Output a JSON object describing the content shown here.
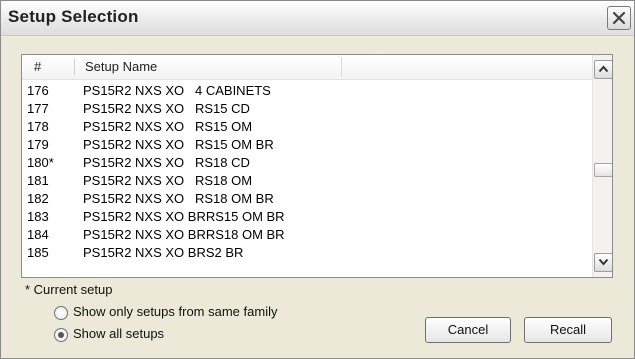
{
  "window": {
    "title": "Setup Selection"
  },
  "list": {
    "columns": [
      "#",
      "Setup Name"
    ],
    "rows": [
      {
        "num": "176",
        "name": "PS15R2 NXS XO   4 CABINETS"
      },
      {
        "num": "177",
        "name": "PS15R2 NXS XO   RS15 CD"
      },
      {
        "num": "178",
        "name": "PS15R2 NXS XO   RS15 OM"
      },
      {
        "num": "179",
        "name": "PS15R2 NXS XO   RS15 OM BR"
      },
      {
        "num": "180*",
        "name": "PS15R2 NXS XO   RS18 CD"
      },
      {
        "num": "181",
        "name": "PS15R2 NXS XO   RS18 OM"
      },
      {
        "num": "182",
        "name": "PS15R2 NXS XO   RS18 OM BR"
      },
      {
        "num": "183",
        "name": "PS15R2 NXS XO BRRS15 OM BR"
      },
      {
        "num": "184",
        "name": "PS15R2 NXS XO BRRS18 OM BR"
      },
      {
        "num": "185",
        "name": "PS15R2 NXS XO BRS2 BR"
      }
    ]
  },
  "footnote": "* Current setup",
  "options": [
    {
      "label": "Show only setups from same family",
      "checked": false
    },
    {
      "label": "Show all setups",
      "checked": true
    }
  ],
  "buttons": {
    "cancel": "Cancel",
    "recall": "Recall"
  }
}
